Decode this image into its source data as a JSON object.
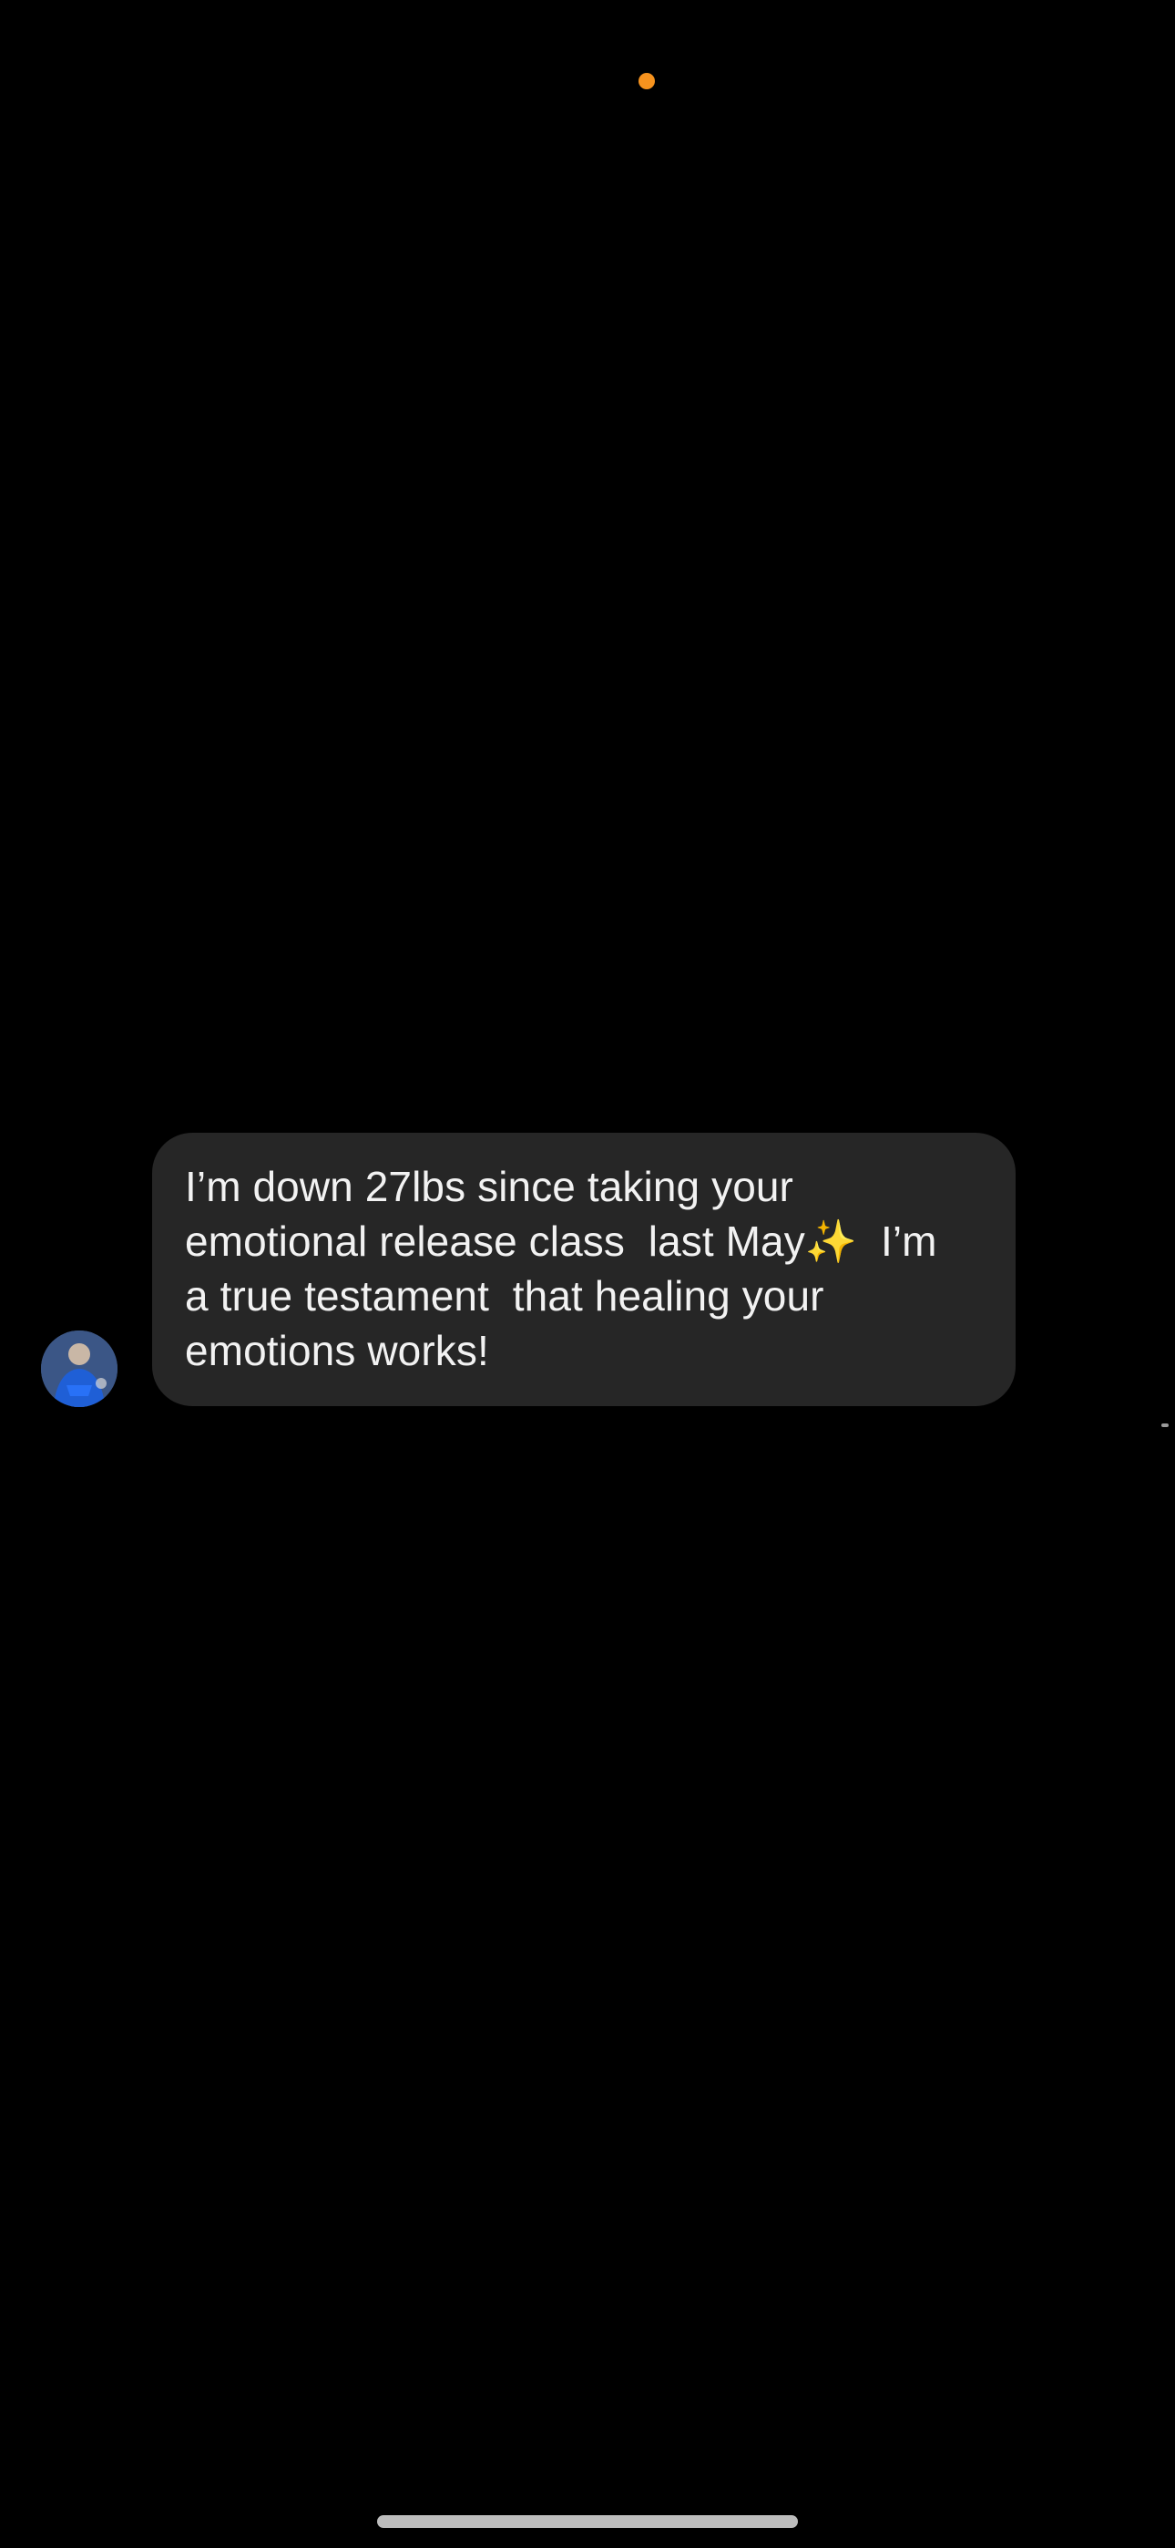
{
  "status": {
    "indicator_color": "#F7931E"
  },
  "conversation": {
    "sender_avatar_icon": "avatar-icon",
    "message": {
      "lines": [
        "I’m down 27lbs since taking your",
        "emotional release class  last May✨  I’m",
        "a true testament  that healing your",
        "emotions works!"
      ]
    }
  },
  "home_indicator": {
    "color": "#BDBDBD"
  }
}
